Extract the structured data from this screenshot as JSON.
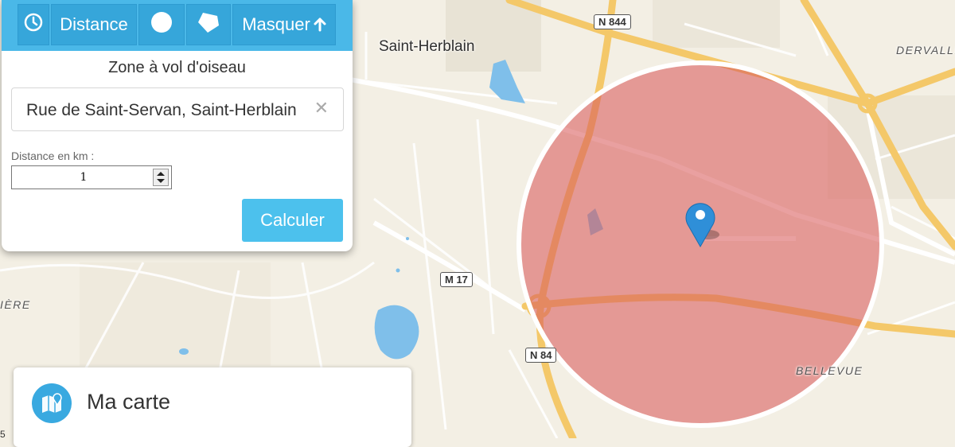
{
  "toolbar": {
    "items": [
      {
        "name": "clock-icon"
      },
      {
        "label": "Distance"
      },
      {
        "name": "circle-icon"
      },
      {
        "name": "polygon-icon"
      },
      {
        "label": "Masquer",
        "icon": "arrow-up-icon"
      }
    ]
  },
  "panel": {
    "title": "Zone à vol d'oiseau",
    "address_value": "Rue de Saint-Servan, Saint-Herblain",
    "clear_glyph": "✕",
    "distance_label": "Distance en km :",
    "distance_value": "1",
    "calculate_label": "Calculer"
  },
  "map": {
    "labels": {
      "city": "Saint-Herblain",
      "district_ne": "DERVALLI",
      "district_w": "IÈRE",
      "district_se": "BELLEVUE"
    },
    "roads": [
      "N 844",
      "M 17",
      "N 84"
    ],
    "zone_color": "#d95c5c",
    "marker_color": "#2f8fd8",
    "edge_letter": "5"
  },
  "card": {
    "title": "Ma carte",
    "icon": "map-marker-icon"
  },
  "colors": {
    "accent": "#4ab8e8",
    "button": "#4cc1ed",
    "road_major": "#f4c869",
    "road_major_in_zone": "#e88f4e",
    "water": "#7fbfea"
  }
}
